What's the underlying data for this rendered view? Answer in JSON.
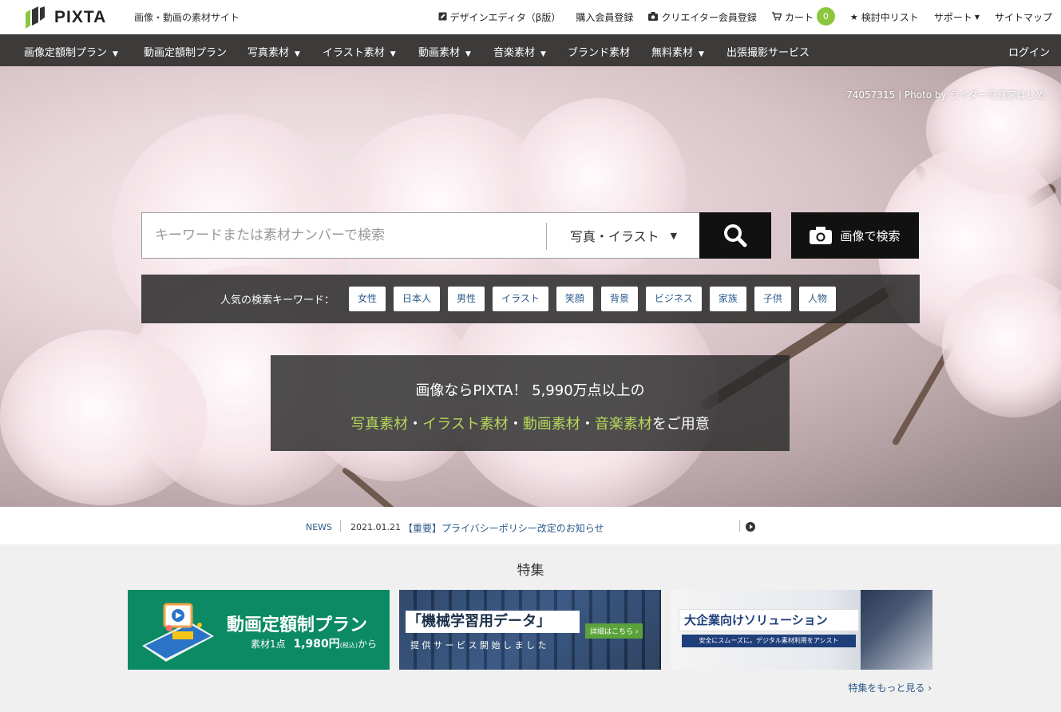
{
  "header": {
    "logo_text": "PIXTA",
    "tagline": "画像・動画の素材サイト",
    "links": {
      "design_editor": "デザインエディタ（β版）",
      "buyer_signup": "購入会員登録",
      "creator_signup": "クリエイター会員登録",
      "cart": "カート",
      "cart_count": "0",
      "wishlist": "検討中リスト",
      "support": "サポート",
      "sitemap": "サイトマップ"
    }
  },
  "nav": {
    "items": [
      "画像定額制プラン",
      "動画定額制プラン",
      "写真素材",
      "イラスト素材",
      "動画素材",
      "音楽素材",
      "ブランド素材",
      "無料素材",
      "出張撮影サービス"
    ],
    "login": "ログイン"
  },
  "hero": {
    "photo_credit": "74057315 | Photo by ライダー写真家はじめ",
    "search": {
      "placeholder": "キーワードまたは素材ナンバーで検索",
      "type_selected": "写真・イラスト"
    },
    "image_search_label": "画像で検索",
    "popular_label": "人気の検索キーワード：",
    "keywords": [
      "女性",
      "日本人",
      "男性",
      "イラスト",
      "笑顔",
      "背景",
      "ビジネス",
      "家族",
      "子供",
      "人物"
    ],
    "promo": {
      "line1": "画像ならPIXTA！ 5,990万点以上の",
      "photo": "写真素材",
      "illust": "イラスト素材",
      "video": "動画素材",
      "music": "音楽素材",
      "dot": "・",
      "suffix": "をご用意"
    }
  },
  "news": {
    "label": "NEWS",
    "date": "2021.01.21",
    "title": "【重要】プライバシーポリシー改定のお知らせ"
  },
  "features": {
    "title": "特集",
    "banners": [
      {
        "title": "動画定額制プラン",
        "sub": "素材1点",
        "price": "1,980円",
        "tax": "(税込)",
        "suffix": "から"
      },
      {
        "title": "「機械学習用データ」",
        "sub": "提 供 サ ー ビ ス 開 始 し ま し た",
        "cta": "詳細はこちら ›"
      },
      {
        "title": "大企業向けソリューション",
        "sub": "安全にスムーズに。デジタル素材利用をアシスト"
      }
    ],
    "more": "特集をもっと見る ›"
  },
  "colors": {
    "accent_green": "#8cc63f",
    "nav_bg": "#3d3a3a",
    "link_blue": "#2a5a8a",
    "promo_green": "#b6d75a"
  }
}
